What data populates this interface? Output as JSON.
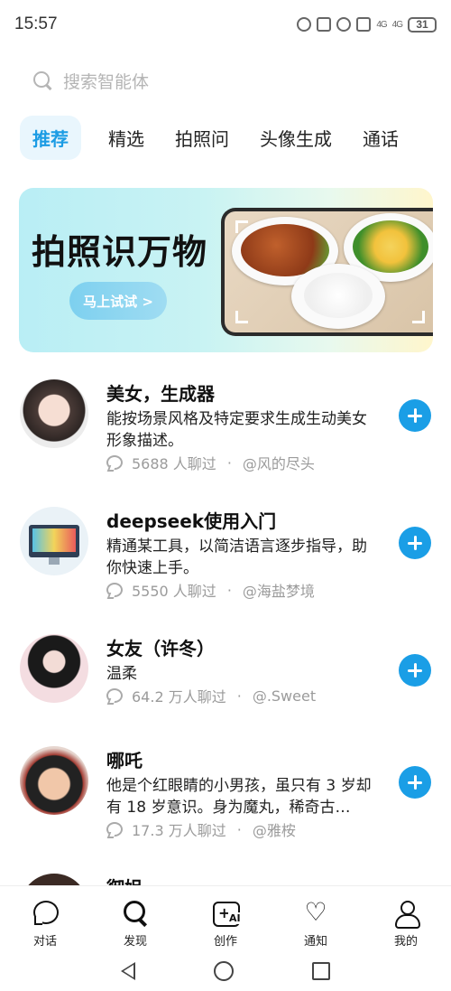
{
  "status_bar": {
    "time": "15:57",
    "battery": "31",
    "signal_1": "4G",
    "signal_2": "4G"
  },
  "search": {
    "placeholder": "搜索智能体"
  },
  "tabs": [
    {
      "label": "推荐",
      "active": true
    },
    {
      "label": "精选",
      "active": false
    },
    {
      "label": "拍照问",
      "active": false
    },
    {
      "label": "头像生成",
      "active": false
    },
    {
      "label": "通话",
      "active": false
    }
  ],
  "banner": {
    "title": "拍照识万物",
    "button_label": "马上试试 >"
  },
  "agents": [
    {
      "title": "美女，生成器",
      "description": "能按场景风格及特定要求生成生动美女形象描述。",
      "chats": "5688 人聊过",
      "author": "@风的尽头"
    },
    {
      "title": "deepseek使用入门",
      "description": "精通某工具，以简洁语言逐步指导，助你快速上手。",
      "chats": "5550 人聊过",
      "author": "@海盐梦境"
    },
    {
      "title": "女友（许冬）",
      "description": "温柔",
      "chats": "64.2 万人聊过",
      "author": "@.Sweet"
    },
    {
      "title": "哪吒",
      "description": "他是个红眼睛的小男孩，虽只有 3 岁却有 18 岁意识。身为魔丸，稀奇古…",
      "chats": "17.3 万人聊过",
      "author": "@雅桉"
    },
    {
      "title": "御姐",
      "description": "",
      "chats": "",
      "author": ""
    }
  ],
  "separator": "·",
  "bottom_nav": [
    {
      "label": "对话",
      "icon": "chat-icon"
    },
    {
      "label": "发现",
      "icon": "search-icon"
    },
    {
      "label": "创作",
      "icon": "create-ai-icon"
    },
    {
      "label": "通知",
      "icon": "heart-icon"
    },
    {
      "label": "我的",
      "icon": "person-icon"
    }
  ],
  "create_icon_text": {
    "plus": "+",
    "ai": "AI"
  },
  "colors": {
    "accent": "#1a9ee6",
    "tab_active_bg": "#e9f6fd",
    "muted_text": "#9b9b9b"
  }
}
